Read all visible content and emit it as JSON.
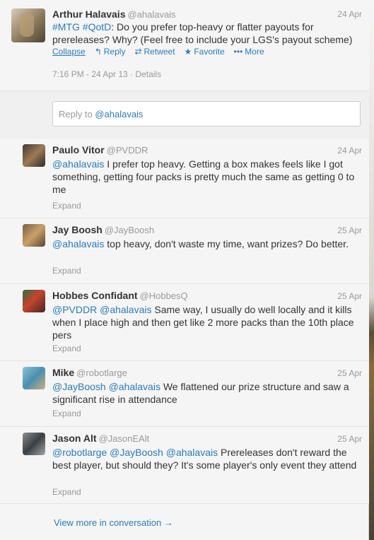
{
  "main": {
    "name": "Arthur Halavais",
    "handle": "@ahalavais",
    "date": "24 Apr",
    "text_parts": {
      "tag1": "#MTG",
      "tag2": "#QotD",
      "rest": ": Do you prefer top-heavy or flatter payouts for prereleases? Why? (Feel free to include your LGS's payout scheme)"
    },
    "actions": {
      "collapse": "Collapse",
      "reply": "Reply",
      "retweet": "Retweet",
      "favorite": "Favorite",
      "more": "More"
    },
    "meta": "7:16 PM - 24 Apr 13 · Details"
  },
  "reply_box": {
    "prefix": "Reply to ",
    "mention": "@ahalavais"
  },
  "replies": [
    {
      "name": "Paulo Vitor",
      "handle": "@PVDDR",
      "date": "24 Apr",
      "mentions": "@ahalavais",
      "text": " I prefer top heavy. Getting a box makes feels like I got something, getting four packs is pretty much the same as getting 0 to me",
      "expand": "Expand"
    },
    {
      "name": "Jay Boosh",
      "handle": "@JayBoosh",
      "date": "25 Apr",
      "mentions": "@ahalavais",
      "text": " top heavy, don't waste my time, want prizes? Do better.",
      "expand": "Expand"
    },
    {
      "name": "Hobbes Confidant",
      "handle": "@HobbesQ",
      "date": "25 Apr",
      "mentions": "@PVDDR @ahalavais",
      "text": " Same way, I usually do well locally and it kills when I place high and then get like 2 more packs than the 10th place pers",
      "expand": "Expand"
    },
    {
      "name": "Mike",
      "handle": "@robotlarge",
      "date": "25 Apr",
      "mentions": "@JayBoosh @ahalavais",
      "text": " We flattened our prize structure and saw a significant rise in attendance",
      "expand": "Expand"
    },
    {
      "name": "Jason Alt",
      "handle": "@JasonEAlt",
      "date": "25 Apr",
      "mentions": "@robotlarge @JayBoosh @ahalavais",
      "text": " Prereleases don't reward the best player, but should they? It's some player's only event they attend",
      "expand": "Expand"
    }
  ],
  "view_more": "View more in conversation →"
}
